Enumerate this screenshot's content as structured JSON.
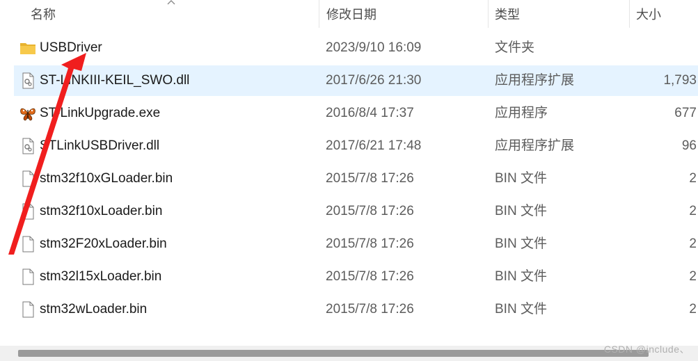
{
  "columns": {
    "name": "名称",
    "date": "修改日期",
    "type": "类型",
    "size": "大小"
  },
  "files": [
    {
      "name": "USBDriver",
      "date": "2023/9/10 16:09",
      "type": "文件夹",
      "size": "",
      "icon": "folder-icon"
    },
    {
      "name": "ST-LINKIII-KEIL_SWO.dll",
      "date": "2017/6/26 21:30",
      "type": "应用程序扩展",
      "size": "1,793",
      "icon": "dll-file-icon",
      "selected": true
    },
    {
      "name": "ST-LinkUpgrade.exe",
      "date": "2016/8/4 17:37",
      "type": "应用程序",
      "size": "677",
      "icon": "butterfly-app-icon"
    },
    {
      "name": "STLinkUSBDriver.dll",
      "date": "2017/6/21 17:48",
      "type": "应用程序扩展",
      "size": "96",
      "icon": "dll-file-icon"
    },
    {
      "name": "stm32f10xGLoader.bin",
      "date": "2015/7/8 17:26",
      "type": "BIN 文件",
      "size": "2",
      "icon": "blank-file-icon"
    },
    {
      "name": "stm32f10xLoader.bin",
      "date": "2015/7/8 17:26",
      "type": "BIN 文件",
      "size": "2",
      "icon": "blank-file-icon"
    },
    {
      "name": "stm32F20xLoader.bin",
      "date": "2015/7/8 17:26",
      "type": "BIN 文件",
      "size": "2",
      "icon": "blank-file-icon"
    },
    {
      "name": "stm32l15xLoader.bin",
      "date": "2015/7/8 17:26",
      "type": "BIN 文件",
      "size": "2",
      "icon": "blank-file-icon"
    },
    {
      "name": "stm32wLoader.bin",
      "date": "2015/7/8 17:26",
      "type": "BIN 文件",
      "size": "2",
      "icon": "blank-file-icon"
    }
  ],
  "watermark": "CSDN @include、",
  "colors": {
    "selected_row": "#e5f3ff",
    "annotation_arrow": "#f01e1e",
    "folder": "#f7c94b"
  }
}
